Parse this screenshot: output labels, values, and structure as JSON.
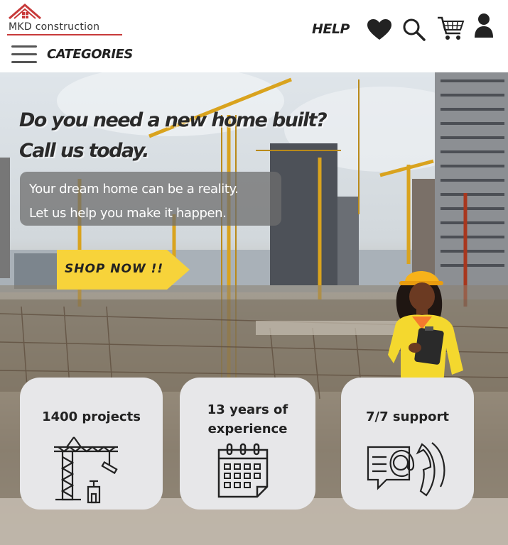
{
  "header": {
    "logo_text": "MKD construction",
    "help_label": "HELP",
    "categories_label": "CATEGORIES",
    "icons": [
      "menu-icon",
      "heart-icon",
      "search-icon",
      "cart-icon",
      "user-icon"
    ]
  },
  "hero": {
    "headline_line1": "Do you need a new home built?",
    "headline_line2": "Call us today.",
    "sub_line1": "Your dream home can be a reality.",
    "sub_line2": "Let us help you make it happen.",
    "shop_label": "SHOP NOW !!"
  },
  "cards": [
    {
      "title": "1400 projects",
      "icon": "tower-crane-icon"
    },
    {
      "title_line1": "13 years of",
      "title_line2": "experience",
      "icon": "calendar-icon"
    },
    {
      "title": "7/7 support",
      "icon": "email-phone-support-icon"
    }
  ],
  "colors": {
    "accent_yellow": "#f7d33a",
    "logo_red": "#c83a3a",
    "card_bg": "#e7e7e9",
    "text_dark": "#222222"
  }
}
